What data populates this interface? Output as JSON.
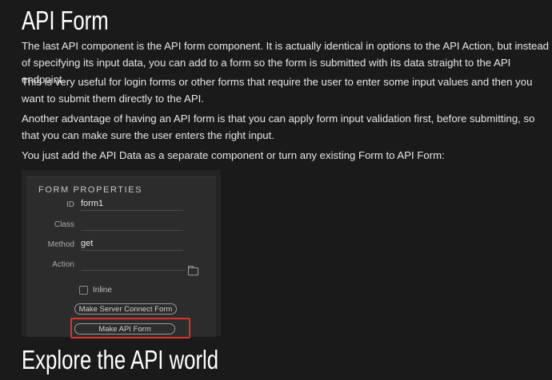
{
  "heading_top": "API Form",
  "paragraphs": [
    "The last API component is the API form component. It is actually identical in options to the API Action, but instead of specifying its input data, you can add to a form so the form is submitted with its data straight to the API endpoint.",
    "This is very useful for login forms or other forms that require the user to enter some input values and then you want to submit them directly to the API.",
    "Another advantage of having an API form is that you can apply form input validation first, before submitting, so that you can make sure the user enters the right input.",
    "You just add the API Data as a separate component or turn any existing Form to API Form:"
  ],
  "form_properties": {
    "title": "FORM PROPERTIES",
    "id_label": "ID",
    "id_value": "form1",
    "class_label": "Class",
    "class_value": "",
    "method_label": "Method",
    "method_value": "get",
    "action_label": "Action",
    "action_value": "",
    "inline_label": "Inline",
    "server_connect_button": "Make Server Connect Form",
    "api_form_button": "Make API Form",
    "highlight_color": "#d9342b"
  },
  "heading_bottom": "Explore the API world"
}
